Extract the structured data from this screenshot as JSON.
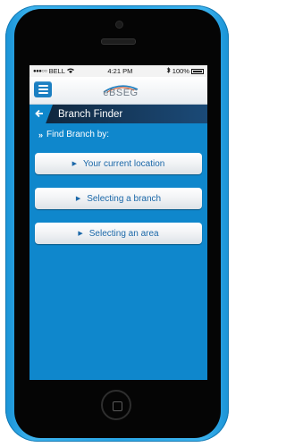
{
  "status_bar": {
    "carrier": "BELL",
    "time": "4:21 PM",
    "battery": "100%",
    "signal_dots": "●●●○○"
  },
  "header": {
    "logo_text": "eBSEG",
    "logo_accent_color": "#1b7fc2"
  },
  "title_bar": {
    "back_icon": "back-arrow-icon",
    "title": "Branch Finder"
  },
  "main": {
    "find_label": "Find Branch by:",
    "options": [
      {
        "label": "Your current location"
      },
      {
        "label": "Selecting a branch"
      },
      {
        "label": "Selecting an area"
      }
    ]
  },
  "colors": {
    "screen_bg": "#0f87cc",
    "title_bar": "#163a5e",
    "device": "#2aa6e6",
    "button_text": "#1a67a8"
  }
}
